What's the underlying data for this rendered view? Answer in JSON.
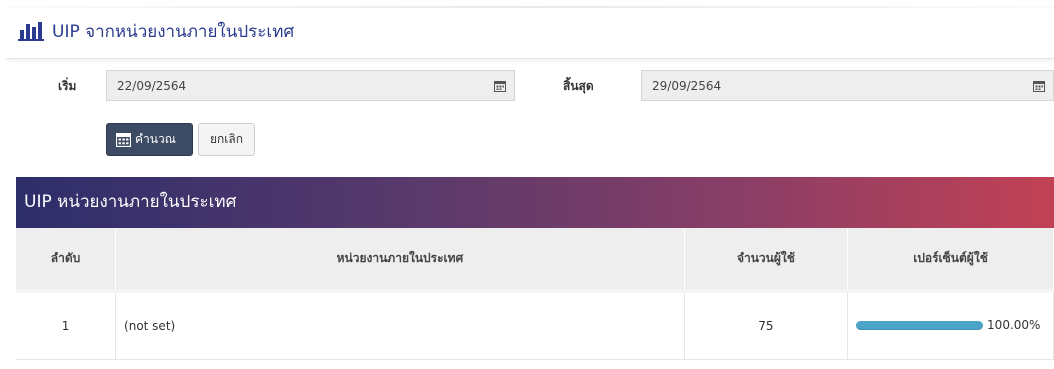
{
  "header": {
    "title": "UIP จากหน่วยงานภายในประเทศ",
    "icon": "bar-chart-icon",
    "accent_color": "#2a3b8f"
  },
  "filters": {
    "start_label": "เริ่ม",
    "start_value": "22/09/2564",
    "end_label": "สิ้นสุด",
    "end_value": "29/09/2564",
    "calendar_icon": "calendar-icon"
  },
  "buttons": {
    "calculate_label": "คำนวณ",
    "calculate_icon": "calculator-icon",
    "cancel_label": "ยกเลิก"
  },
  "table": {
    "title": "UIP หน่วยงานภายในประเทศ",
    "columns": [
      "ลำดับ",
      "หน่วยงานภายในประเทศ",
      "จำนวนผู้ใช้",
      "เปอร์เซ็นต์ผู้ใช้"
    ],
    "rows": [
      {
        "rank": "1",
        "agency": "(not set)",
        "users": "75",
        "percent": "100.00%",
        "percent_value": 100
      }
    ],
    "progress_color": "#4ba3c6"
  }
}
